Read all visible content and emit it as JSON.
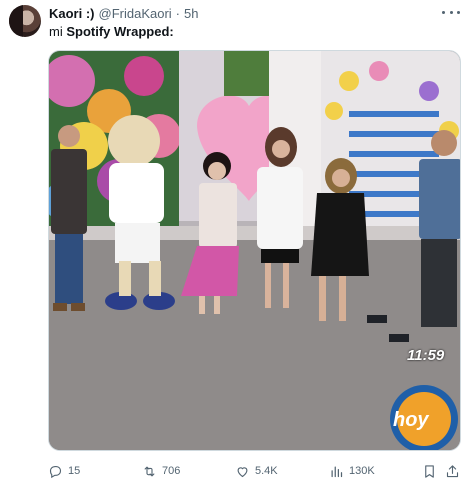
{
  "tweet": {
    "author_name": "Kaori :)",
    "handle": "@FridaKaori",
    "separator": "·",
    "time": "5h",
    "text_prefix": "mi",
    "text_bold": "Spotify Wrapped:"
  },
  "media": {
    "clock": "11:59"
  },
  "actions": {
    "replies": "15",
    "retweets": "706",
    "likes": "5.4K",
    "views": "130K"
  },
  "colors": {
    "text": "#0f1419",
    "muted": "#536471",
    "border": "#cfd9de"
  },
  "icons": [
    "more-icon",
    "reply-icon",
    "retweet-icon",
    "like-icon",
    "views-icon",
    "bookmark-icon",
    "share-icon"
  ]
}
